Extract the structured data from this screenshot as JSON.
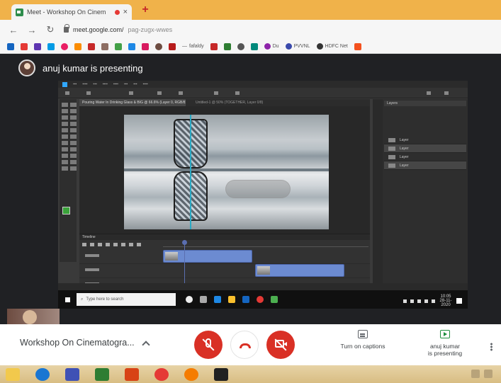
{
  "browser": {
    "tab_title": "Meet - Workshop On Cinem",
    "tab_close": "×",
    "new_tab": "+",
    "url_domain": "meet.google.com/",
    "url_path": "pag-zugx-wwes",
    "bookmarks": [
      "fafaldy",
      "Du",
      "PVVNL",
      "HDFC Net"
    ]
  },
  "meet": {
    "presenter_text": "anuj kumar is presenting",
    "meeting_title": "Workshop On Cinematogra...",
    "captions_label": "Turn on captions",
    "presenting_label_1": "anuj kumar",
    "presenting_label_2": "is presenting"
  },
  "shared_screen": {
    "doc_tab": "Pouring Water In Drinking Glass & BIG @ 66.6% (Layer 0, RGB/8)",
    "doc_tab_2": "Untitled-1 @ 50% (TOGETHER, Layer 0/8)",
    "timeline_label": "Timeline",
    "taskbar_search": "Type here to search",
    "clock_time": "10:05",
    "clock_date": "28-11-2020",
    "layers_tab": "Layers",
    "layers": [
      "Layer",
      "Layer",
      "Layer",
      "Layer"
    ]
  },
  "colors": {
    "browser_tab_strip": "#f0b24a",
    "meet_red": "#d93025",
    "meet_stage": "#202124",
    "presenting_green": "#1e8e3e",
    "host_taskbar": "#d8bd83"
  }
}
